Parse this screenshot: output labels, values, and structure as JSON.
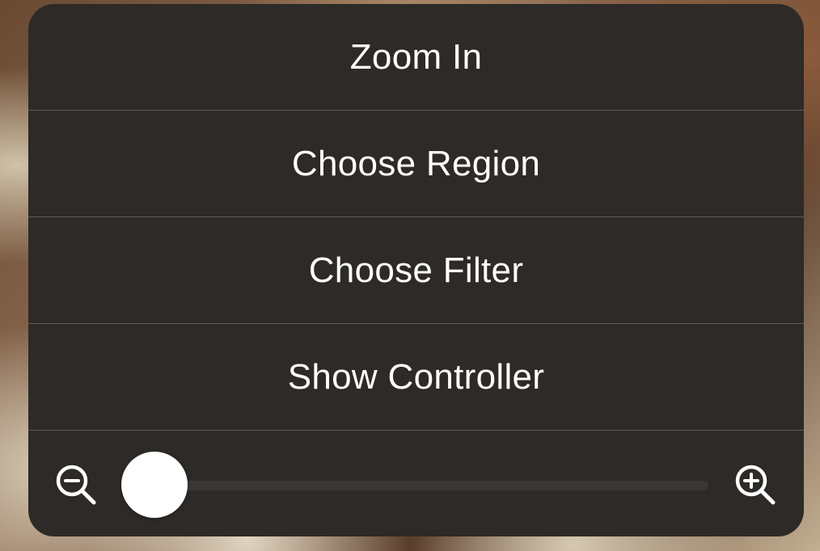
{
  "menu": {
    "items": [
      {
        "label": "Zoom In"
      },
      {
        "label": "Choose Region"
      },
      {
        "label": "Choose Filter"
      },
      {
        "label": "Show Controller"
      }
    ]
  },
  "zoom_slider": {
    "min_icon": "zoom-out-magnifier-icon",
    "max_icon": "zoom-in-magnifier-icon",
    "level": 0.0
  },
  "colors": {
    "menu_background": "#2d2a27",
    "text": "#ffffff",
    "divider": "#5f5b57",
    "track": "#3a3734",
    "thumb": "#ffffff"
  }
}
